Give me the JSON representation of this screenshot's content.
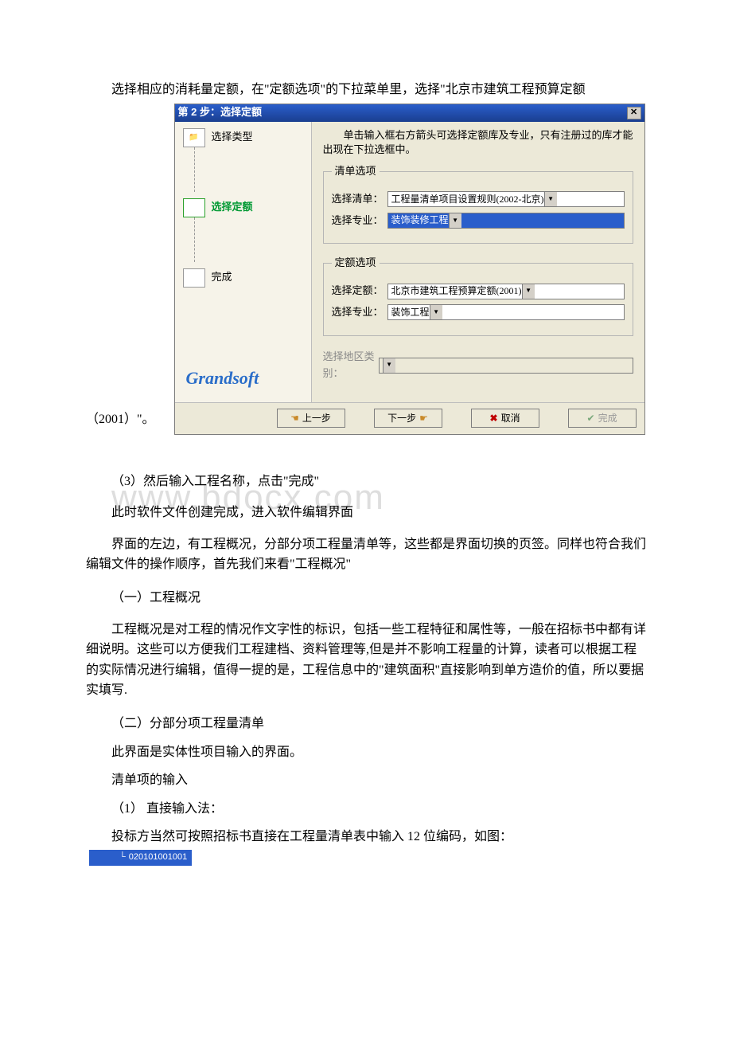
{
  "intro": "选择相应的消耗量定额，在\"定额选项\"的下拉菜单里，选择\"北京市建筑工程预算定额",
  "yearSuffix": "（2001）\"。",
  "dialog": {
    "title": "第 2 步：选择定额",
    "closeGlyph": "✕",
    "steps": {
      "selectType": "选择类型",
      "selectQuota": "选择定额",
      "finish": "完成"
    },
    "brand": "Grandsoft",
    "hintText": "单击输入框右方箭头可选择定额库及专业，只有注册过的库才能出现在下拉选框中。",
    "group1": {
      "legend": "清单选项",
      "label1": "选择清单：",
      "value1": "工程量清单项目设置规则(2002-北京)",
      "label2": "选择专业：",
      "value2": "装饰装修工程"
    },
    "group2": {
      "legend": "定额选项",
      "label1": "选择定额：",
      "value1": "北京市建筑工程预算定额(2001)",
      "label2": "选择专业：",
      "value2": "装饰工程"
    },
    "regionLabel": "选择地区类别：",
    "buttons": {
      "prev": "上一步",
      "next": "下一步",
      "cancel": "取消",
      "finish": "完成"
    }
  },
  "watermark": "www.bdocx.com",
  "body": {
    "p1": "（3）然后输入工程名称，点击\"完成\"",
    "p2": "此时软件文件创建完成，进入软件编辑界面",
    "p3": "界面的左边，有工程概况，分部分项工程量清单等，这些都是界面切换的页签。同样也符合我们编辑文件的操作顺序，首先我们来看\"工程概况\"",
    "h1": "（一）工程概况",
    "p4": "工程概况是对工程的情况作文字性的标识，包括一些工程特征和属性等，一般在招标书中都有详细说明。这些可以方便我们工程建档、资料管理等,但是并不影响工程量的计算，读者可以根据工程的实际情况进行编辑，值得一提的是，工程信息中的\"建筑面积\"直接影响到单方造价的值，所以要据实填写.",
    "h2": "（二）分部分项工程量清单",
    "p5": "此界面是实体性项目输入的界面。",
    "p6": "清单项的输入",
    "p7": "（1） 直接输入法：",
    "p8": "投标方当然可按照招标书直接在工程量清单表中输入 12 位编码，如图：",
    "codeValue": "020101001001"
  }
}
